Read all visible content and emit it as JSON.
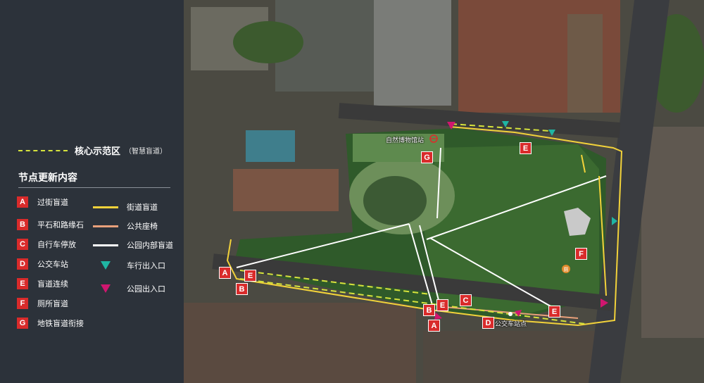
{
  "panel": {
    "core_area_title": "核心示范区",
    "core_area_subtitle": "（智慧盲道）",
    "section_title": "节点更新内容",
    "nodes": [
      {
        "letter": "A",
        "label": "过街盲道"
      },
      {
        "letter": "B",
        "label": "平石和路缘石"
      },
      {
        "letter": "C",
        "label": "自行车停放"
      },
      {
        "letter": "D",
        "label": "公交车站"
      },
      {
        "letter": "E",
        "label": "盲道连续"
      },
      {
        "letter": "F",
        "label": "厕所盲道"
      },
      {
        "letter": "G",
        "label": "地铁盲道衔接"
      }
    ],
    "lines": [
      {
        "label": "街道盲道",
        "color": "#f2d23a"
      },
      {
        "label": "公共座椅",
        "color": "#e8a07a"
      },
      {
        "label": "公园内部盲道",
        "color": "#ffffff"
      },
      {
        "label": "车行出入口",
        "color": "#1fb5a3"
      },
      {
        "label": "公园出入口",
        "color": "#d0166f"
      }
    ]
  },
  "map": {
    "labels": {
      "museum_station": "自然博物馆站",
      "bus_stop": "公交车站点",
      "toilet_glyph": "厕"
    },
    "badges": {
      "a1": "A",
      "a2": "A",
      "b1": "B",
      "b2": "B",
      "c1": "C",
      "d1": "D",
      "e1": "E",
      "e2": "E",
      "e3": "E",
      "e4": "E",
      "f1": "F",
      "g1": "G"
    }
  }
}
